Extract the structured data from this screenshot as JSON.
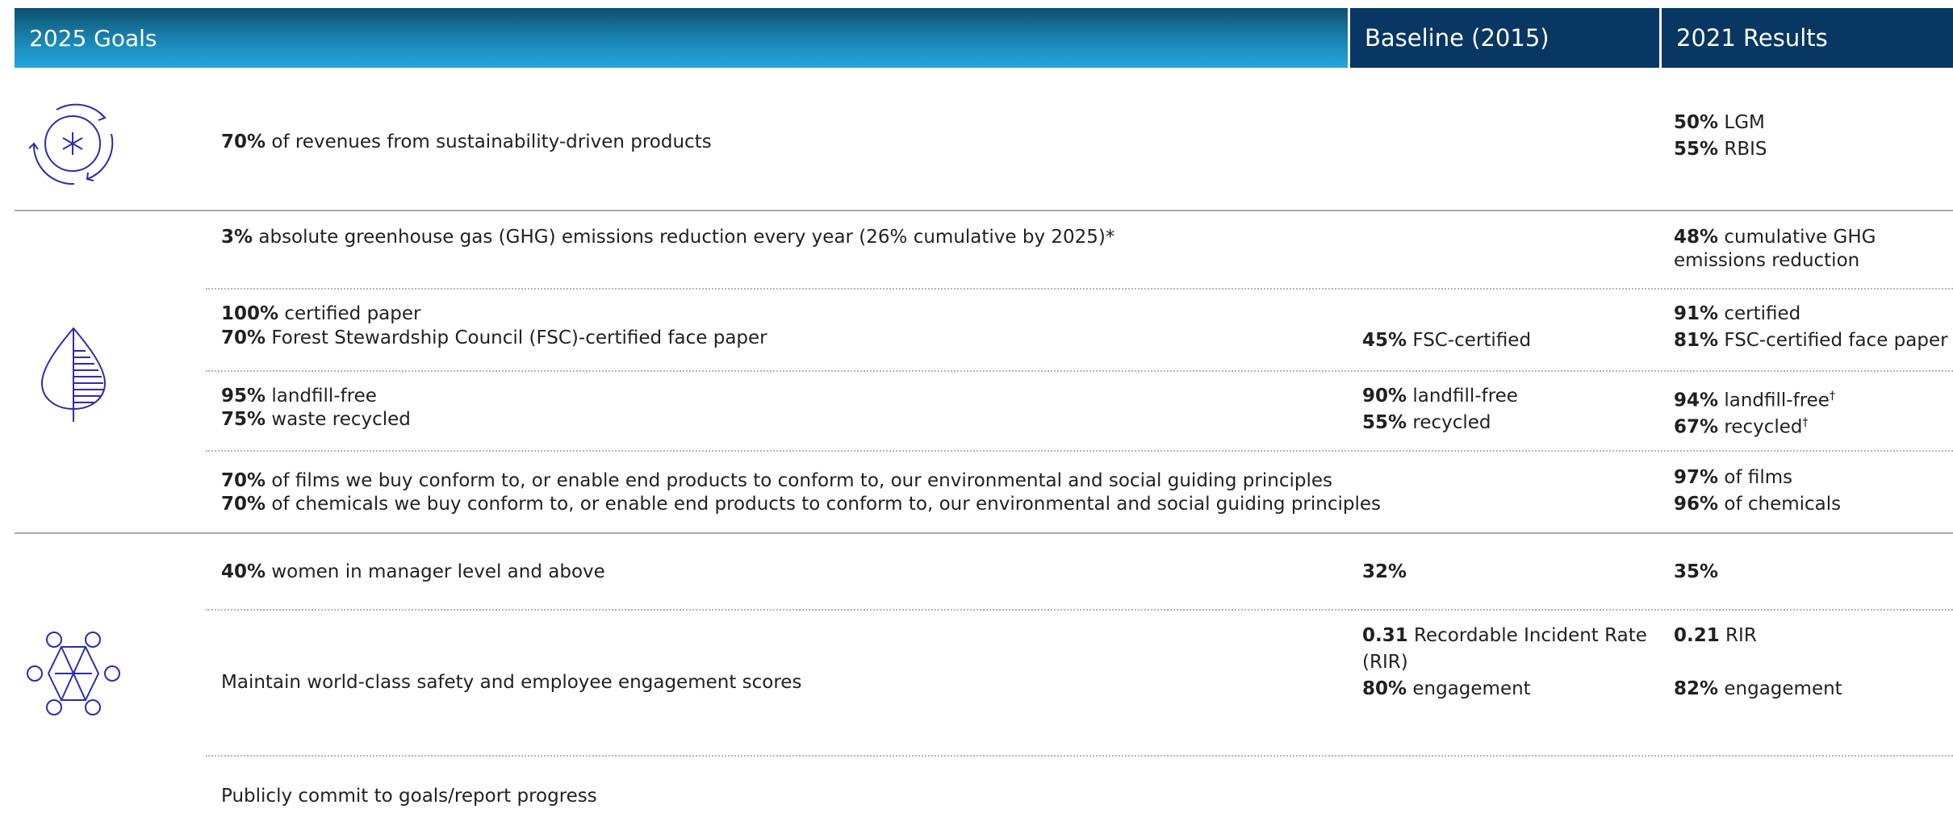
{
  "header": {
    "goals": "2025 Goals",
    "baseline": "Baseline (2015)",
    "results": "2021 Results"
  },
  "rows": {
    "r1": {
      "goal": {
        "b": "70%",
        "t": " of revenues from sustainability-driven products"
      },
      "result1": {
        "b": "50%",
        "t": " LGM"
      },
      "result2": {
        "b": "55%",
        "t": " RBIS"
      }
    },
    "r2": {
      "goal": {
        "b": "3%",
        "t": " absolute greenhouse gas (GHG) emissions reduction every year (26% cumulative by 2025)*"
      },
      "result1": {
        "b": "48%",
        "t": " cumulative GHG"
      },
      "result2": {
        "t": "emissions reduction"
      }
    },
    "r3": {
      "goal1": {
        "b": "100%",
        "t": " certified paper"
      },
      "goal2": {
        "b": "70%",
        "t": " Forest Stewardship Council (FSC)-certified face paper"
      },
      "baseline": {
        "b": "45%",
        "t": " FSC-certified"
      },
      "result1": {
        "b": "91%",
        "t": " certified"
      },
      "result2": {
        "b": "81%",
        "t": " FSC-certified face paper"
      }
    },
    "r4": {
      "goal1": {
        "b": "95%",
        "t": " landfill-free"
      },
      "goal2": {
        "b": "75%",
        "t": " waste recycled"
      },
      "baseline1": {
        "b": "90%",
        "t": " landfill-free"
      },
      "baseline2": {
        "b": "55%",
        "t": " recycled"
      },
      "result1": {
        "b": "94%",
        "t": " landfill-free",
        "sup": "†"
      },
      "result2": {
        "b": "67%",
        "t": " recycled",
        "sup": "†"
      }
    },
    "r5": {
      "goal1": {
        "b": "70%",
        "t": " of films we buy conform to, or enable end products to conform to, our environmental and social guiding principles"
      },
      "goal2": {
        "b": "70%",
        "t": " of chemicals we buy conform to, or enable end products to conform to, our environmental and social guiding principles"
      },
      "result1": {
        "b": "97%",
        "t": " of films"
      },
      "result2": {
        "b": "96%",
        "t": " of chemicals"
      }
    },
    "r6": {
      "goal": {
        "b": "40%",
        "t": " women in manager level and above"
      },
      "baseline": {
        "b": "32%"
      },
      "result": {
        "b": "35%"
      }
    },
    "r7": {
      "goal": {
        "t": "Maintain world-class safety and employee engagement scores"
      },
      "baseline1": {
        "b": "0.31",
        "t": " Recordable Incident Rate"
      },
      "baseline1b": {
        "t": "(RIR)"
      },
      "baseline2": {
        "b": "80%",
        "t": " engagement"
      },
      "result1": {
        "b": "0.21",
        "t": " RIR"
      },
      "result2": {
        "b": "82%",
        "t": " engagement"
      }
    },
    "r8": {
      "goal": {
        "t": "Publicly commit to goals/report progress"
      }
    }
  },
  "icons": {
    "products": "recycle-circle-icon",
    "environment": "leaf-icon",
    "people": "people-network-icon"
  },
  "colors": {
    "header_gradient_top": "#0e506e",
    "header_gradient_bottom": "#23a6db",
    "header_dark": "#083764",
    "icon_stroke": "#2e2bb0",
    "text": "#231f20"
  }
}
